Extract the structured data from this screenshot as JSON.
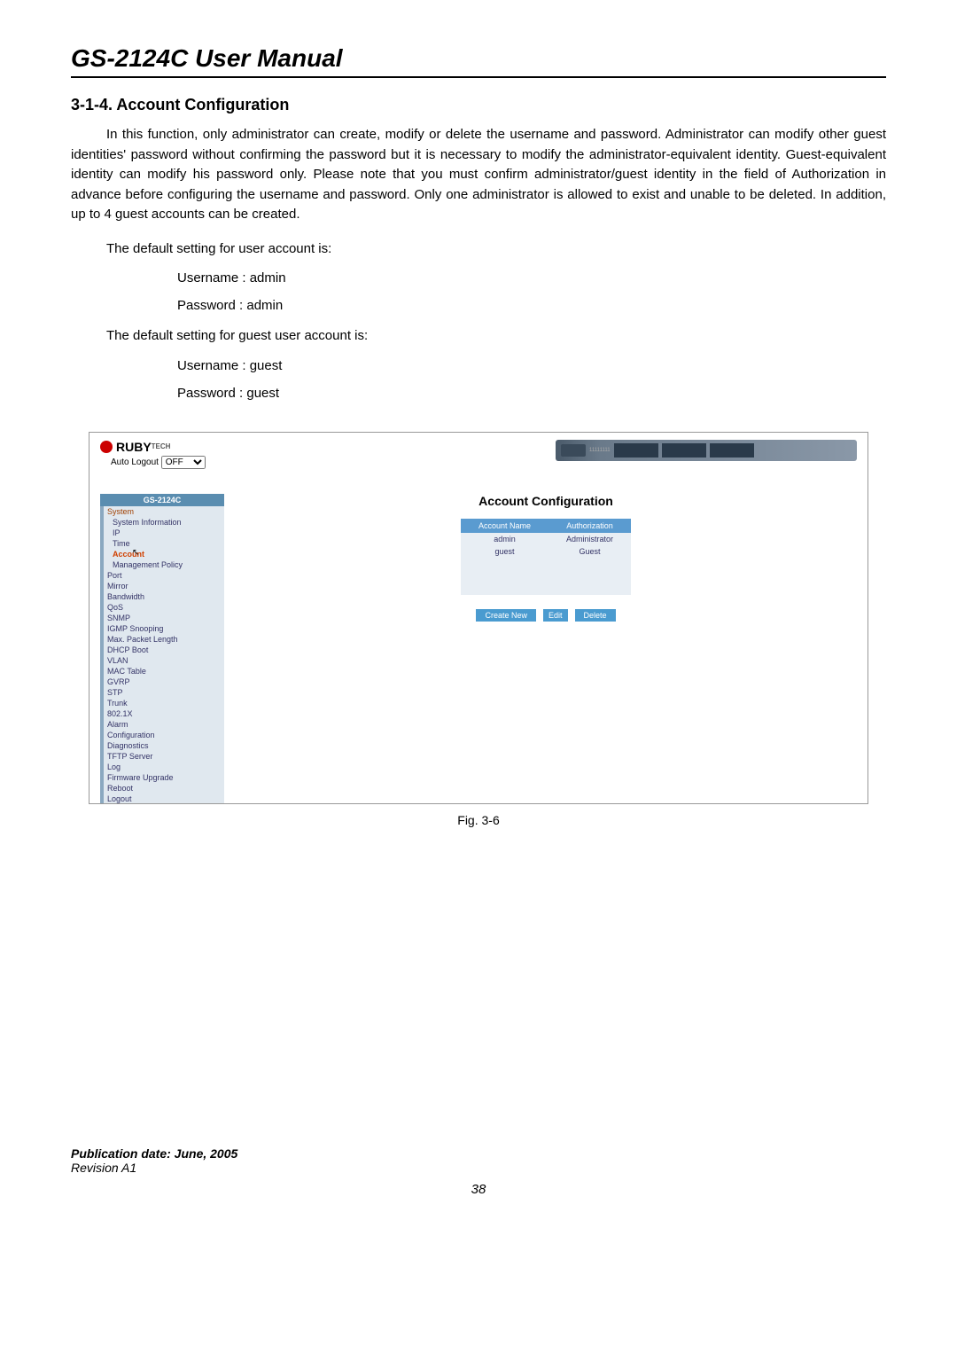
{
  "header": {
    "title": "GS-2124C User Manual"
  },
  "section": {
    "title": "3-1-4. Account Configuration",
    "body": "In this function, only administrator can create, modify or delete the username and password. Administrator can modify other guest identities' password without confirming the password but it is necessary to modify the administrator-equivalent identity. Guest-equivalent identity can modify his password only. Please note that you must confirm administrator/guest identity in the field of Authorization in advance before configuring the username and password. Only one administrator is allowed to exist and unable to be deleted. In addition, up to 4 guest accounts can be created.",
    "default_user_label": "The default setting for user account is:",
    "user_username": "Username : admin",
    "user_password": "Password  : admin",
    "default_guest_label": "The default setting for guest user account is:",
    "guest_username": "Username : guest",
    "guest_password": "Password  : guest"
  },
  "screenshot": {
    "logo": "RUBY",
    "logo_suffix": "TECH",
    "auto_logout_label": "Auto Logout",
    "auto_logout_value": "OFF",
    "sidebar_title": "GS-2124C",
    "sidebar_items": [
      {
        "label": "System",
        "class": "system"
      },
      {
        "label": "System Information",
        "class": "sub"
      },
      {
        "label": "IP",
        "class": "sub"
      },
      {
        "label": "Time",
        "class": "sub"
      },
      {
        "label": "Account",
        "class": "sub active"
      },
      {
        "label": "Management Policy",
        "class": "sub"
      },
      {
        "label": "Port",
        "class": ""
      },
      {
        "label": "Mirror",
        "class": ""
      },
      {
        "label": "Bandwidth",
        "class": ""
      },
      {
        "label": "QoS",
        "class": ""
      },
      {
        "label": "SNMP",
        "class": ""
      },
      {
        "label": "IGMP Snooping",
        "class": ""
      },
      {
        "label": "Max. Packet Length",
        "class": ""
      },
      {
        "label": "DHCP Boot",
        "class": ""
      },
      {
        "label": "VLAN",
        "class": ""
      },
      {
        "label": "MAC Table",
        "class": ""
      },
      {
        "label": "GVRP",
        "class": ""
      },
      {
        "label": "STP",
        "class": ""
      },
      {
        "label": "Trunk",
        "class": ""
      },
      {
        "label": "802.1X",
        "class": ""
      },
      {
        "label": "Alarm",
        "class": ""
      },
      {
        "label": "Configuration",
        "class": ""
      },
      {
        "label": "Diagnostics",
        "class": ""
      },
      {
        "label": "TFTP Server",
        "class": ""
      },
      {
        "label": "Log",
        "class": ""
      },
      {
        "label": "Firmware Upgrade",
        "class": ""
      },
      {
        "label": "Reboot",
        "class": ""
      },
      {
        "label": "Logout",
        "class": ""
      }
    ],
    "main_title": "Account Configuration",
    "table": {
      "headers": [
        "Account Name",
        "Authorization"
      ],
      "rows": [
        {
          "name": "admin",
          "auth": "Administrator"
        },
        {
          "name": "guest",
          "auth": "Guest"
        }
      ]
    },
    "buttons": {
      "create": "Create New",
      "edit": "Edit",
      "delete": "Delete"
    }
  },
  "figure_caption": "Fig. 3-6",
  "footer": {
    "publication": "Publication date: June, 2005",
    "revision": "Revision A1",
    "page": "38"
  }
}
